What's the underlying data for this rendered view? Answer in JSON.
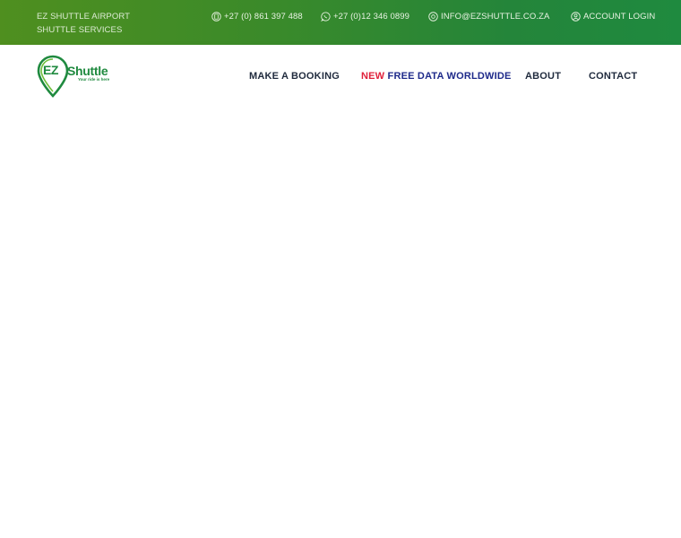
{
  "topbar": {
    "company": "EZ SHUTTLE AIRPORT SHUTTLE SERVICES",
    "phone": "+27 (0) 861 397 488",
    "whatsapp": "+27 (0)12 346 0899",
    "email": "INFO@EZSHUTTLE.CO.ZA",
    "login": "ACCOUNT LOGIN",
    "icons": {
      "phone": "phone-icon",
      "whatsapp": "whatsapp-icon",
      "email": "at-icon",
      "login": "user-icon"
    },
    "gradient_start": "#4f8f1f",
    "gradient_end": "#1f8a3f"
  },
  "logo": {
    "badge": "EZ",
    "wordmark": "Shuttle",
    "tagline": "Your ride is here",
    "color": "#1f8a3f"
  },
  "nav": {
    "booking": "MAKE A BOOKING",
    "data_new": "NEW",
    "data_label": "FREE DATA WORLDWIDE",
    "about": "ABOUT",
    "contact": "CONTACT",
    "new_color": "#e0203a",
    "data_color": "#1e2a8a"
  }
}
